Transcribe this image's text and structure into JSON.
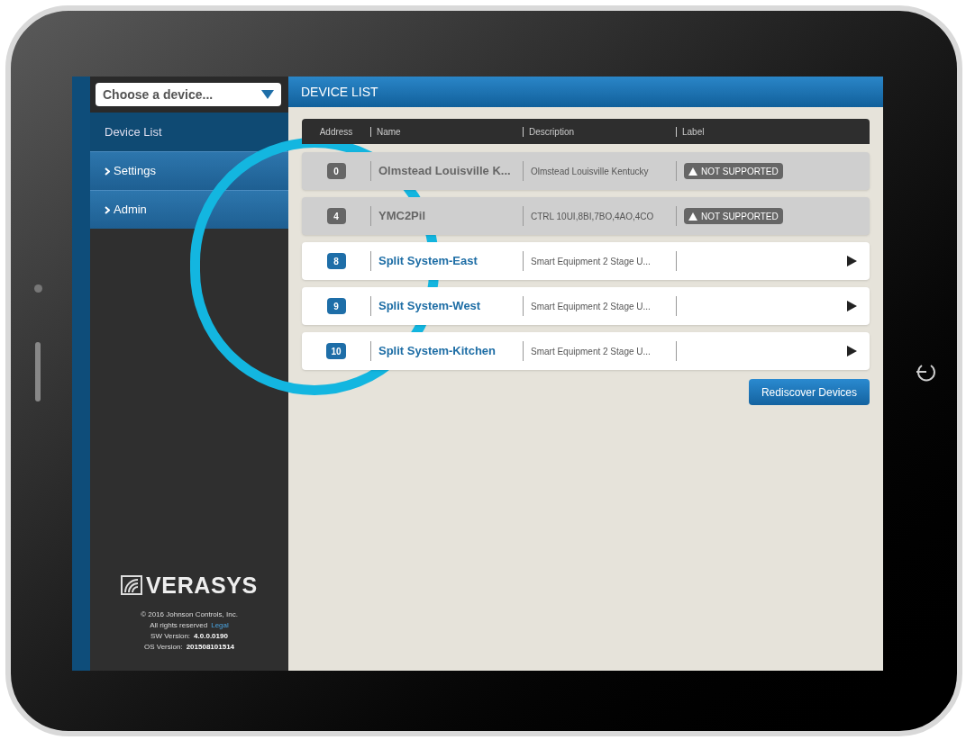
{
  "device_select": {
    "placeholder": "Choose a device..."
  },
  "nav": [
    {
      "label": "Device List",
      "kind": "page",
      "selected": true
    },
    {
      "label": "Settings",
      "kind": "menu",
      "selected": false
    },
    {
      "label": "Admin",
      "kind": "menu",
      "selected": false
    }
  ],
  "footer": {
    "brand": "VERASYS",
    "copyright": "© 2016 Johnson Controls, Inc.",
    "rights": "All rights reserved",
    "legal_link": "Legal",
    "sw_label": "SW Version:",
    "sw_value": "4.0.0.0190",
    "os_label": "OS Version:",
    "os_value": "201508101514"
  },
  "header": {
    "title": "DEVICE LIST"
  },
  "table": {
    "columns": [
      "Address",
      "Name",
      "Description",
      "Label"
    ],
    "rows": [
      {
        "address": "0",
        "name": "Olmstead Louisville K...",
        "description": "Olmstead Louisville Kentucky",
        "label": "NOT SUPPORTED",
        "supported": false
      },
      {
        "address": "4",
        "name": "YMC2Pil",
        "description": "CTRL 10UI,8BI,7BO,4AO,4CO",
        "label": "NOT SUPPORTED",
        "supported": false
      },
      {
        "address": "8",
        "name": "Split System-East",
        "description": "Smart Equipment 2 Stage U...",
        "supported": true
      },
      {
        "address": "9",
        "name": "Split System-West",
        "description": "Smart Equipment 2 Stage U...",
        "supported": true
      },
      {
        "address": "10",
        "name": "Split System-Kitchen",
        "description": "Smart Equipment 2 Stage U...",
        "supported": true
      }
    ]
  },
  "rediscover_button": "Rediscover Devices"
}
